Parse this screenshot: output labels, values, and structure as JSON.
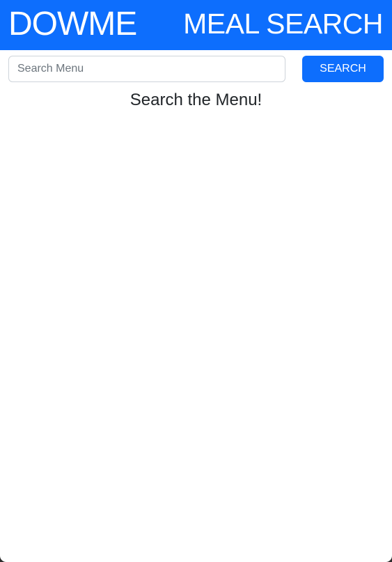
{
  "header": {
    "brand": "DOWME",
    "title": "MEAL SEARCH"
  },
  "search": {
    "placeholder": "Search Menu",
    "value": "",
    "button_label": "SEARCH"
  },
  "main": {
    "prompt": "Search the Menu!"
  },
  "colors": {
    "primary": "#0d6efd",
    "text": "#212529",
    "input_border": "#ced4da",
    "placeholder": "#6c757d"
  }
}
